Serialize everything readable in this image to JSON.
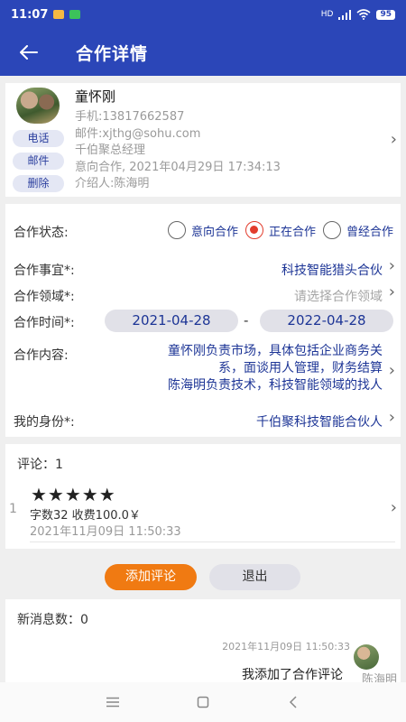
{
  "status_bar": {
    "time": "11:07",
    "network": "HD",
    "battery": "95"
  },
  "app_bar": {
    "title": "合作详情"
  },
  "contact": {
    "name": "童怀刚",
    "phone": "手机:13817662587",
    "email": "邮件:xjthg@sohu.com",
    "position": "千伯聚总经理",
    "intent": "意向合作, 2021年04月29日 17:34:13",
    "introducer": "介绍人:陈海明",
    "actions": {
      "call": "电话",
      "mail": "邮件",
      "delete": "删除"
    }
  },
  "details": {
    "status": {
      "label": "合作状态:",
      "options": [
        {
          "label": "意向合作",
          "selected": false
        },
        {
          "label": "正在合作",
          "selected": true
        },
        {
          "label": "曾经合作",
          "selected": false
        }
      ]
    },
    "matter": {
      "label": "合作事宜*:",
      "value": "科技智能猎头合伙"
    },
    "field": {
      "label": "合作领域*:",
      "placeholder": "请选择合作领域"
    },
    "time": {
      "label": "合作时间*:",
      "start": "2021-04-28",
      "separator": "-",
      "end": "2022-04-28"
    },
    "content": {
      "label": "合作内容:",
      "lines": [
        "童怀刚负责市场，具体包括企业商务关",
        "系，面谈用人管理，财务结算",
        "陈海明负责技术，科技智能领域的找人"
      ]
    },
    "identity": {
      "label": "我的身份*:",
      "value": "千伯聚科技智能合伙人"
    }
  },
  "comments": {
    "header": "评论：1",
    "items": [
      {
        "index": "1",
        "stars": "★★★★★",
        "meta": "字数32  收费100.0￥",
        "time": "2021年11月09日 11:50:33"
      }
    ]
  },
  "buttons": {
    "add_comment": "添加评论",
    "exit": "退出"
  },
  "messages": {
    "header": "新消息数：0",
    "items": [
      {
        "time": "2021年11月09日 11:50:33",
        "text": "我添加了合作评论",
        "sender": "陈海明"
      }
    ]
  },
  "colors": {
    "primary": "#2b46b8",
    "accent": "#e23c2c",
    "orange": "#f07a12",
    "link": "#1d3596"
  }
}
